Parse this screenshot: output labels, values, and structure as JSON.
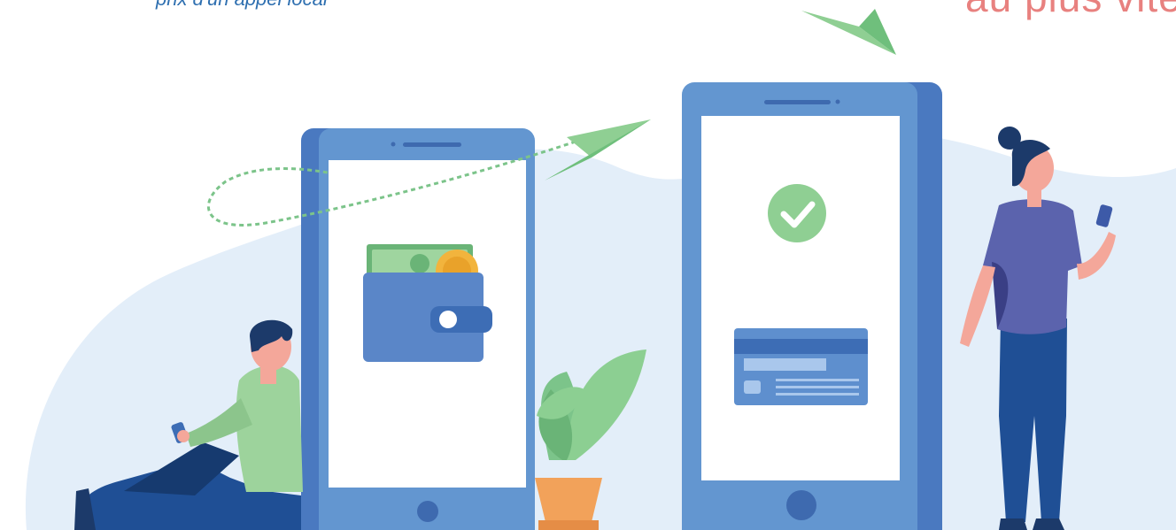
{
  "text": {
    "caption": "prix d'un appel local",
    "headline": "au plus vite"
  },
  "colors": {
    "blob": "#e3eef9",
    "phone_body": "#6396d0",
    "phone_shade": "#4a79c0",
    "screen": "#ffffff",
    "green": "#8fcf93",
    "green_dark": "#5fae6c",
    "wallet": "#5a86c8",
    "coin": "#f2b43d",
    "card_top": "#3d6db5",
    "card_body": "#5e8fce",
    "card_line": "#a9c7ec",
    "man_shirt": "#9dd39c",
    "man_pants": "#1f4f95",
    "woman_shirt": "#5b63ad",
    "woman_pants": "#1f4f95",
    "hair": "#1c3a6a",
    "skin": "#f4a79a",
    "pot": "#f2a25a",
    "leaf": "#8ccf92"
  },
  "icons": [
    "paper-plane-icon",
    "wallet-icon",
    "coin-icon",
    "check-icon",
    "credit-card-icon",
    "plant-icon"
  ]
}
